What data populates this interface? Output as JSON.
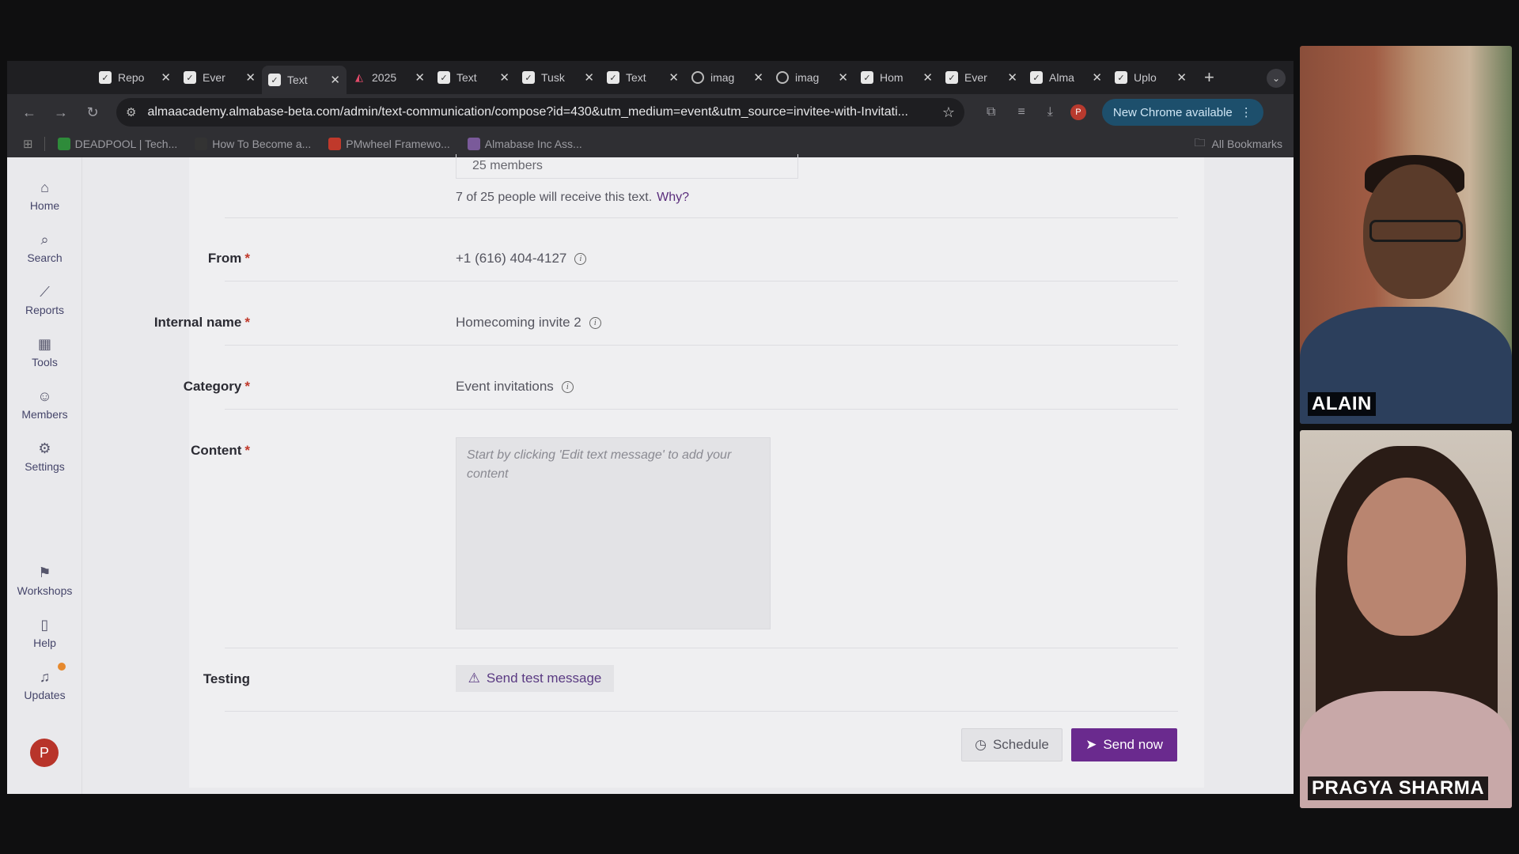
{
  "browser": {
    "tabs": [
      {
        "label": "Repo",
        "icon": "check"
      },
      {
        "label": "Ever",
        "icon": "check"
      },
      {
        "label": "Text",
        "icon": "check",
        "active": true
      },
      {
        "label": "2025",
        "icon": "fire"
      },
      {
        "label": "Text",
        "icon": "check"
      },
      {
        "label": "Tusk",
        "icon": "check"
      },
      {
        "label": "Text",
        "icon": "check"
      },
      {
        "label": "imag",
        "icon": "globe"
      },
      {
        "label": "imag",
        "icon": "globe"
      },
      {
        "label": "Hom",
        "icon": "check"
      },
      {
        "label": "Ever",
        "icon": "check"
      },
      {
        "label": "Alma",
        "icon": "check"
      },
      {
        "label": "Uplo",
        "icon": "check"
      }
    ],
    "url": "almaacademy.almabase-beta.com/admin/text-communication/compose?id=430&utm_medium=event&utm_source=invitee-with-Invitati...",
    "new_chrome_label": "New Chrome available",
    "profile_initial": "P",
    "bookmarks": [
      {
        "label": "DEADPOOL | Tech...",
        "color": "#2e8b3a"
      },
      {
        "label": "How To Become a...",
        "color": "#333333"
      },
      {
        "label": "PMwheel Framewo...",
        "color": "#c0392b"
      },
      {
        "label": "Almabase Inc Ass...",
        "color": "#7a5a9a"
      }
    ],
    "all_bookmarks_label": "All Bookmarks"
  },
  "sidebar": {
    "items": [
      {
        "label": "Home",
        "icon": "home-icon",
        "glyph": "⌂"
      },
      {
        "label": "Search",
        "icon": "search-icon",
        "glyph": "⌕"
      },
      {
        "label": "Reports",
        "icon": "chart-icon",
        "glyph": "⟋"
      },
      {
        "label": "Tools",
        "icon": "grid-icon",
        "glyph": "▦"
      },
      {
        "label": "Members",
        "icon": "people-icon",
        "glyph": "☺"
      },
      {
        "label": "Settings",
        "icon": "gear-icon",
        "glyph": "⚙"
      },
      {
        "label": "Workshops",
        "icon": "workshop-icon",
        "glyph": "⚑"
      },
      {
        "label": "Help",
        "icon": "book-icon",
        "glyph": "▯"
      },
      {
        "label": "Updates",
        "icon": "bell-icon",
        "glyph": "♫"
      }
    ],
    "avatar_initial": "P"
  },
  "form": {
    "members_count": "25 members",
    "recipients_note": "7 of 25 people will receive this text.",
    "why_link": "Why?",
    "from_label": "From",
    "from_value": "+1 (616) 404-4127",
    "internal_name_label": "Internal name",
    "internal_name_value": "Homecoming invite 2",
    "category_label": "Category",
    "category_value": "Event invitations",
    "content_label": "Content",
    "content_placeholder": "Start by clicking 'Edit text message' to add your content",
    "testing_label": "Testing",
    "send_test_label": "Send test message",
    "required_mark": "*",
    "schedule_label": "Schedule",
    "send_now_label": "Send now"
  },
  "participants": [
    {
      "name": "ALAIN"
    },
    {
      "name": "PRAGYA SHARMA"
    }
  ],
  "colors": {
    "accent": "#6a2a8e",
    "link": "#5a2d7c",
    "required": "#c0392b"
  }
}
